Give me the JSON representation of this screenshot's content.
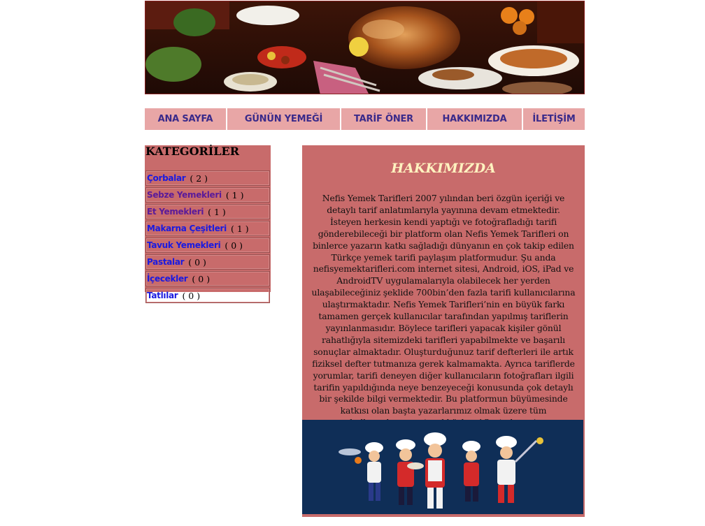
{
  "nav": {
    "items": [
      "ANA SAYFA",
      "GÜNÜN YEMEĞİ",
      "TARİF ÖNER",
      "HAKKIMIZDA",
      "İLETİŞİM"
    ]
  },
  "sidebar": {
    "title": "KATEGORİLER",
    "categories": [
      {
        "name": "Çorbalar",
        "count": "( 2 )"
      },
      {
        "name": "Sebze Yemekleri",
        "count": "( 1 )"
      },
      {
        "name": "Et Yemekleri",
        "count": "( 1 )"
      },
      {
        "name": "Makarna Çeşitleri",
        "count": "( 1 )"
      },
      {
        "name": "Tavuk Yemekleri",
        "count": "( 0 )"
      },
      {
        "name": "Pastalar",
        "count": "( 0 )"
      },
      {
        "name": "İçecekler",
        "count": "( 0 )"
      },
      {
        "name": "Tatlılar",
        "count": "( 0 )"
      }
    ]
  },
  "main": {
    "title": "HAKKIMIZDA",
    "text": "Nefis Yemek Tarifleri 2007 yılından beri özgün içeriği ve detaylı tarif anlatımlarıyla yayınına devam etmektedir. İsteyen herkesin kendi yaptığı ve fotoğrafladığı tarifi gönderebileceği bir platform olan Nefis Yemek Tarifleri on binlerce yazarın katkı sağladığı dünyanın en çok takip edilen Türkçe yemek tarifi paylaşım platformudur. Şu anda nefisyemektarifleri.com internet sitesi, Android, iOS, iPad ve AndroidTV uygulamalarıyla olabilecek her yerden ulaşabileceğiniz şeklide 700bin’den fazla tarifi kullanıcılarına ulaştırmaktadır. Nefis Yemek Tarifleri’nin en büyük farkı tamamen gerçek kullanıcılar tarafından yapılmış tariflerin yayınlanmasıdır. Böylece tarifleri yapacak kişiler gönül rahatlığıyla sitemizdeki tarifleri yapabilmekte ve başarılı sonuçlar almaktadır. Oluşturduğunuz tarif defterleri ile artık fiziksel defter tutmanıza gerek kalmamakta. Ayrıca tariflerde yorumlar, tarifi deneyen diğer kullanıcıların fotoğrafları ilgili tarifin yapıldığında neye benzeyeceği konusunda çok detaylı bir şekilde bilgi vermektedir. Bu platformun büyümesinde katkısı olan başta yazarlarımız olmak üzere tüm kullanıcılarımıza teşekkürler. Afiyet olsun :)"
  },
  "colors": {
    "nav_bg": "#e8a6a6",
    "nav_text": "#3a2a8a",
    "panel_bg": "#c86b6b",
    "title_color": "#fff3c0",
    "link_color": "#1a1ae0",
    "chef_bg": "#0f2e57"
  }
}
